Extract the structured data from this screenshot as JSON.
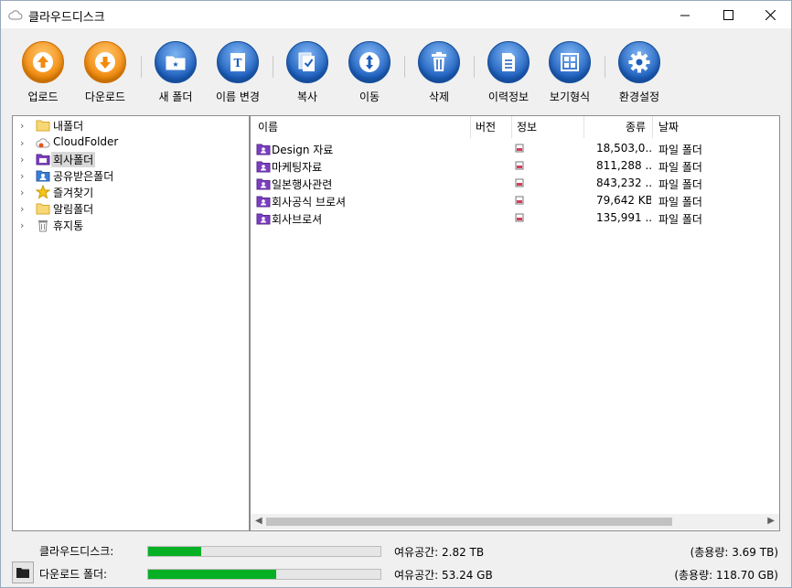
{
  "window": {
    "title": "클라우드디스크"
  },
  "toolbar": {
    "buttons": [
      {
        "label": "업로드",
        "icon": "upload-icon",
        "color": "orange"
      },
      {
        "label": "다운로드",
        "icon": "download-icon",
        "color": "orange"
      },
      {
        "label": "새 폴더",
        "icon": "new-folder-icon",
        "color": "blue"
      },
      {
        "label": "이름 변경",
        "icon": "rename-icon",
        "color": "blue"
      },
      {
        "label": "복사",
        "icon": "copy-icon",
        "color": "blue"
      },
      {
        "label": "이동",
        "icon": "move-icon",
        "color": "blue"
      },
      {
        "label": "삭제",
        "icon": "trash-icon",
        "color": "blue"
      },
      {
        "label": "이력정보",
        "icon": "history-icon",
        "color": "blue"
      },
      {
        "label": "보기형식",
        "icon": "view-grid-icon",
        "color": "blue"
      },
      {
        "label": "환경설정",
        "icon": "gear-icon",
        "color": "blue"
      }
    ]
  },
  "tree": {
    "items": [
      {
        "label": "내폴더",
        "icon": "yellow-folder-icon"
      },
      {
        "label": "CloudFolder",
        "icon": "cloud-icon"
      },
      {
        "label": "회사폴더",
        "icon": "purple-folder-icon",
        "selected": true
      },
      {
        "label": "공유받은폴더",
        "icon": "shared-folder-icon"
      },
      {
        "label": "즐겨찾기",
        "icon": "star-icon"
      },
      {
        "label": "알림폴더",
        "icon": "yellow-folder-icon"
      },
      {
        "label": "휴지통",
        "icon": "trash-icon"
      }
    ]
  },
  "list": {
    "columns": {
      "name": "이름",
      "version": "버전",
      "info": "정보",
      "type": "종류",
      "date": "날짜"
    },
    "rows": [
      {
        "name": "Design 자료",
        "size": "18,503,0...",
        "type": "파일 폴더"
      },
      {
        "name": "마케팅자료",
        "size": "811,288 ...",
        "type": "파일 폴더"
      },
      {
        "name": "일본행사관련",
        "size": "843,232 ...",
        "type": "파일 폴더"
      },
      {
        "name": "회사공식 브로셔",
        "size": "79,642 KB",
        "type": "파일 폴더"
      },
      {
        "name": "회사브로셔",
        "size": "135,991 ...",
        "type": "파일 폴더"
      }
    ]
  },
  "status": {
    "cloud": {
      "label": "클라우드디스크:",
      "progress": 0.23,
      "free": "여유공간: 2.82 TB",
      "total": "(총용량: 3.69 TB)"
    },
    "download": {
      "label": "다운로드 폴더:",
      "progress": 0.55,
      "free": "여유공간: 53.24 GB",
      "total": "(총용량: 118.70 GB)"
    }
  },
  "colors": {
    "progress": "#06b025",
    "orange": "#f28a0a",
    "blue": "#1c5fbe",
    "purple_folder": "#7b3fbf"
  }
}
